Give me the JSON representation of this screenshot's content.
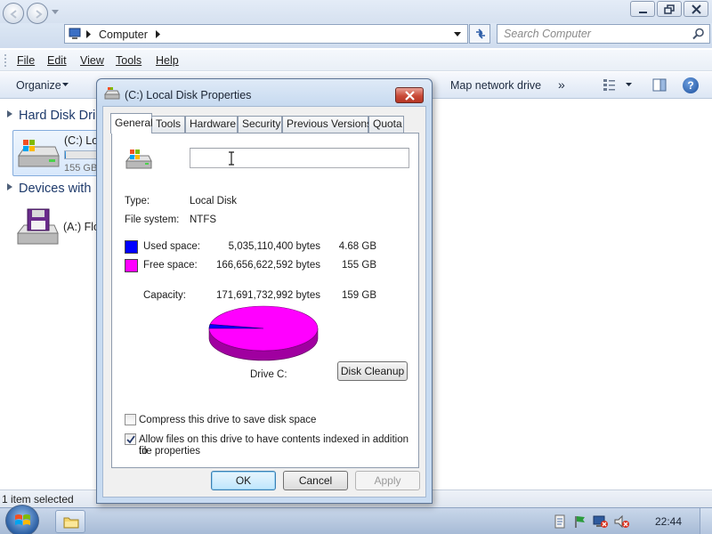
{
  "explorer": {
    "address": {
      "crumb": "Computer"
    },
    "search": {
      "placeholder": "Search Computer"
    },
    "menu": [
      "File",
      "Edit",
      "View",
      "Tools",
      "Help"
    ],
    "command_bar": {
      "organize": "Organize",
      "map_network_drive": "Map network drive",
      "more": "»"
    },
    "groups": [
      {
        "title": "Hard Disk Drives",
        "visible_title": "Hard Disk Dri"
      },
      {
        "title": "Devices with Removable Storage",
        "visible_title": "Devices with"
      }
    ],
    "drives": [
      {
        "label": "(C:) Local Disk",
        "visible_label": "(C:) Loc",
        "free_text": "155 GB",
        "used_fraction": 0.03
      },
      {
        "label": "(A:) Floppy Disk Drive",
        "visible_label": "(A:) Flo"
      }
    ],
    "status": "1 item selected"
  },
  "dialog": {
    "title": "(C:) Local Disk Properties",
    "tabs": [
      "General",
      "Tools",
      "Hardware",
      "Security",
      "Previous Versions",
      "Quota"
    ],
    "active_tab": "General",
    "name_value": "",
    "type_label": "Type:",
    "type_value": "Local Disk",
    "fs_label": "File system:",
    "fs_value": "NTFS",
    "used": {
      "label": "Used space:",
      "bytes": "5,035,110,400 bytes",
      "size": "4.68 GB",
      "color": "#0000ff"
    },
    "free": {
      "label": "Free space:",
      "bytes": "166,656,622,592 bytes",
      "size": "155 GB",
      "color": "#ff00ff"
    },
    "capacity": {
      "label": "Capacity:",
      "bytes": "171,691,732,992 bytes",
      "size": "159 GB"
    },
    "pie": {
      "used_fraction": 0.0293,
      "used_color": "#0000ff",
      "free_color": "#ff00ff",
      "free_side_color": "#a000a0",
      "used_side_color": "#000080"
    },
    "drive_caption": "Drive C:",
    "disk_cleanup": "Disk Cleanup",
    "compress": {
      "label": "Compress this drive to save disk space",
      "checked": false
    },
    "index": {
      "label_line1": "Allow files on this drive to have contents indexed in addition to",
      "label_line2": "file properties",
      "checked": true
    },
    "buttons": {
      "ok": "OK",
      "cancel": "Cancel",
      "apply": "Apply"
    }
  },
  "taskbar": {
    "clock": "22:44"
  }
}
